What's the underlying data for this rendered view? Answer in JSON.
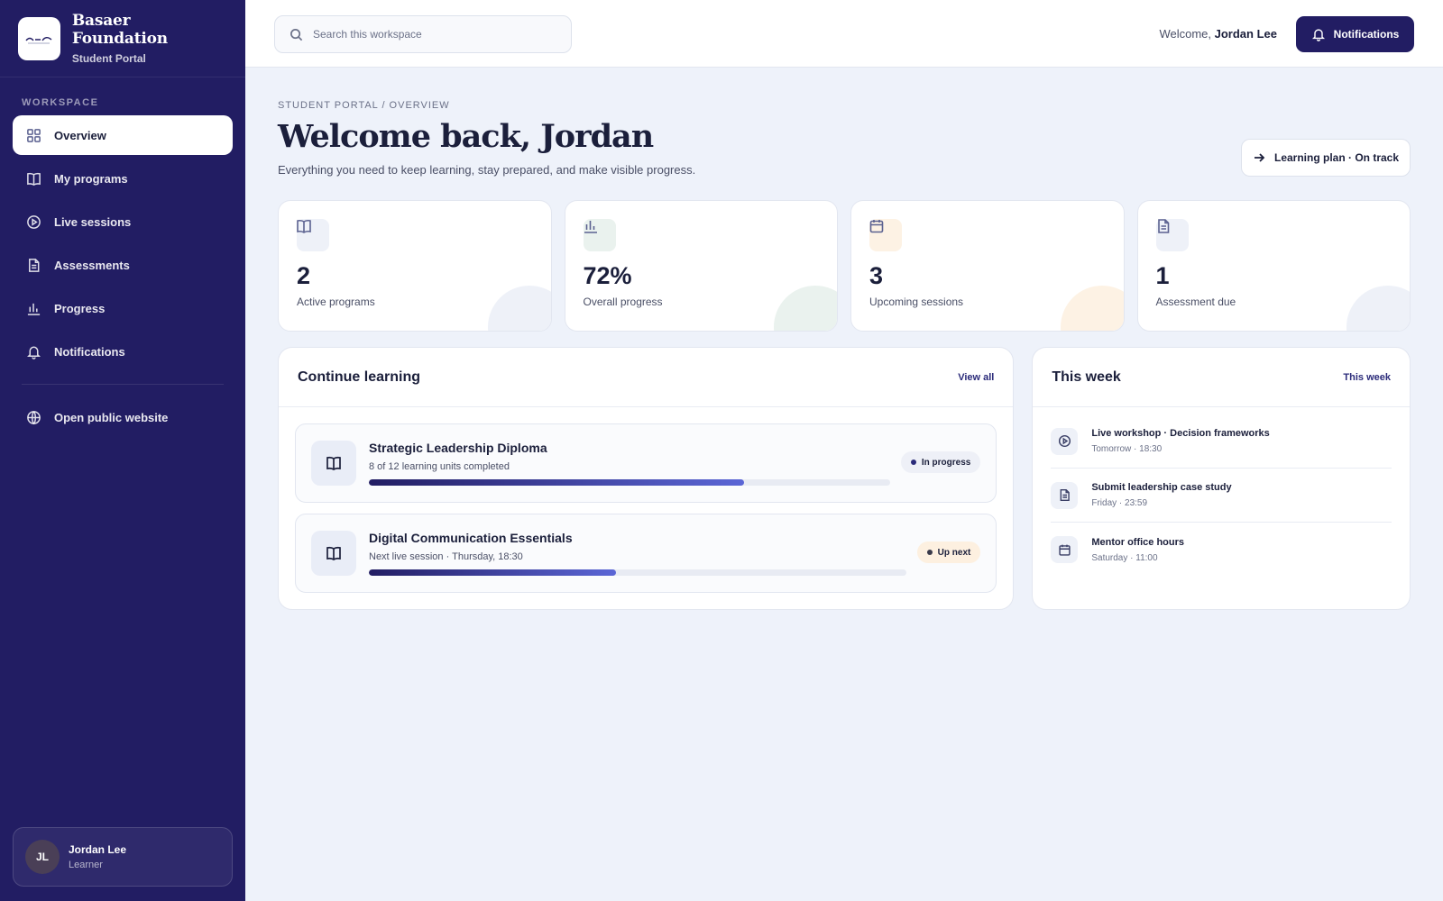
{
  "brand": {
    "name": "Basaer Foundation",
    "subtitle": "Student Portal"
  },
  "sidebar": {
    "section_label": "WORKSPACE",
    "items": [
      {
        "label": "Overview",
        "icon": "grid-icon",
        "active": true
      },
      {
        "label": "My programs",
        "icon": "book-icon"
      },
      {
        "label": "Live sessions",
        "icon": "play-circle-icon"
      },
      {
        "label": "Assessments",
        "icon": "document-icon"
      },
      {
        "label": "Progress",
        "icon": "bar-chart-icon"
      },
      {
        "label": "Notifications",
        "icon": "bell-icon"
      }
    ],
    "external_link": {
      "label": "Open public website",
      "icon": "globe-icon"
    },
    "user": {
      "initials": "JL",
      "name": "Jordan Lee",
      "role": "Learner"
    }
  },
  "topbar": {
    "search_placeholder": "Search this workspace",
    "welcome_prefix": "Welcome,",
    "welcome_name": "Jordan Lee",
    "notifications_label": "Notifications"
  },
  "page": {
    "breadcrumb": "STUDENT PORTAL / OVERVIEW",
    "title": "Welcome back, Jordan",
    "subtitle": "Everything you need to keep learning, stay prepared, and make visible progress.",
    "plan_button": "Learning plan · On track"
  },
  "stats": [
    {
      "value": "2",
      "label": "Active programs",
      "icon": "book-icon",
      "tint": "#eef1f8",
      "deco": "#eef1f8"
    },
    {
      "value": "72%",
      "label": "Overall progress",
      "icon": "bar-chart-icon",
      "tint": "#eaf2ee",
      "deco": "#eaf2ee"
    },
    {
      "value": "3",
      "label": "Upcoming sessions",
      "icon": "calendar-icon",
      "tint": "#fdf2e4",
      "deco": "#fdf2e4"
    },
    {
      "value": "1",
      "label": "Assessment due",
      "icon": "document-icon",
      "tint": "#eef1f8",
      "deco": "#eef1f8"
    }
  ],
  "continue_learning": {
    "title": "Continue learning",
    "link": "View all",
    "courses": [
      {
        "name": "Strategic Leadership Diploma",
        "meta": "8 of 12 learning units completed",
        "progress": 0.72,
        "badge": "In progress"
      },
      {
        "name": "Digital Communication Essentials",
        "meta": "Next live session · Thursday, 18:30",
        "progress": 0.46,
        "badge": "Up next"
      }
    ]
  },
  "this_week": {
    "title": "This week",
    "link": "This week",
    "events": [
      {
        "title": "Live workshop · Decision frameworks",
        "time": "Tomorrow · 18:30",
        "icon": "play-circle-icon"
      },
      {
        "title": "Submit leadership case study",
        "time": "Friday · 23:59",
        "icon": "document-icon"
      },
      {
        "title": "Mentor office hours",
        "time": "Saturday · 11:00",
        "icon": "calendar-icon"
      }
    ]
  },
  "colors": {
    "sidebar": "#221d63",
    "accent": "#221d63",
    "background": "#eef2fa"
  }
}
